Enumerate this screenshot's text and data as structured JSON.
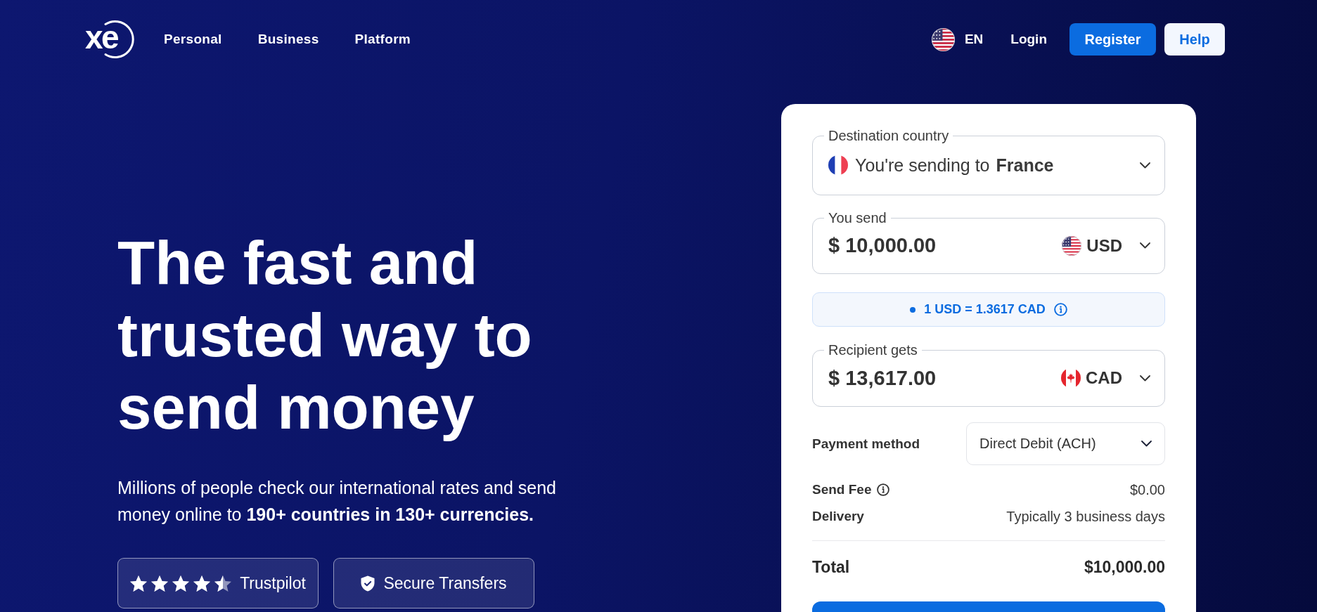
{
  "header": {
    "logo": "xe",
    "nav": [
      "Personal",
      "Business",
      "Platform"
    ],
    "language": "EN",
    "login": "Login",
    "register": "Register",
    "help": "Help"
  },
  "hero": {
    "title": "The fast and trusted way to send money",
    "subtitle": "Millions of people check our international rates and send money online to **190+ countries in 130+ currencies.**",
    "badges": [
      {
        "kind": "rating",
        "label": "Trustpilot",
        "stars": 4.5
      },
      {
        "kind": "secure",
        "label": "Secure Transfers"
      }
    ]
  },
  "transfer_card": {
    "destination": {
      "label": "Destination country",
      "prefix": "You're sending to",
      "country": "France"
    },
    "send": {
      "label": "You send",
      "amount": "$ 10,000.00",
      "currency": "USD"
    },
    "rate": "1 USD = 1.3617 CAD",
    "receive": {
      "label": "Recipient gets",
      "amount": "$ 13,617.00",
      "currency": "CAD"
    },
    "payment_method": {
      "label": "Payment method",
      "value": "Direct Debit (ACH)"
    },
    "details": [
      {
        "label": "Send Fee",
        "value": "$0.00",
        "info": true
      },
      {
        "label": "Delivery",
        "value": "Typically 3 business days",
        "info": false
      }
    ],
    "total": {
      "label": "Total",
      "value": "$10,000.00"
    }
  }
}
